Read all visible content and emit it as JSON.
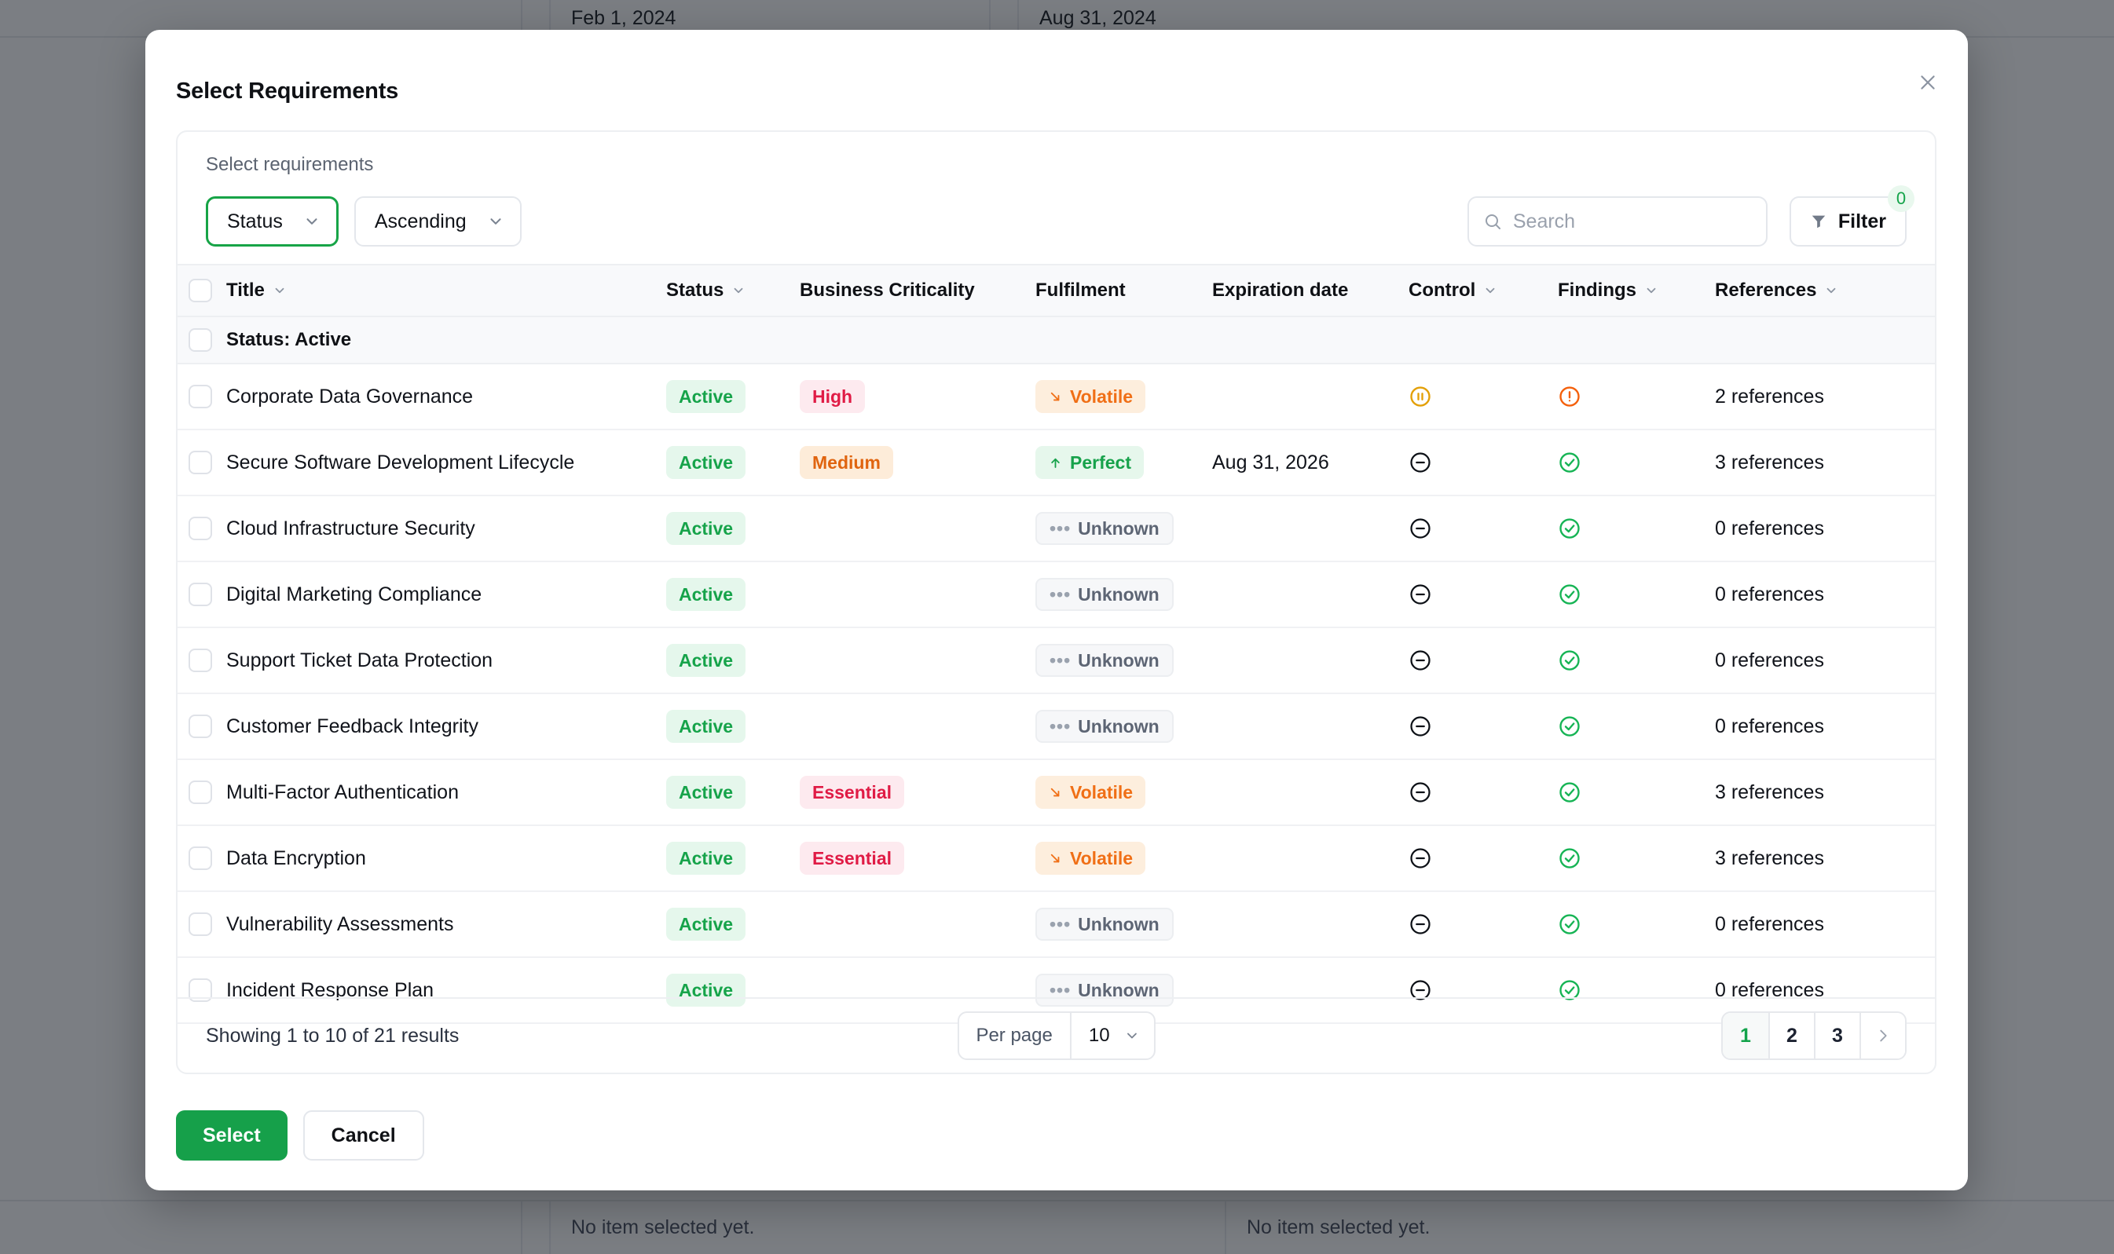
{
  "background": {
    "top_cells": [
      "Feb 1, 2024",
      "Aug 31, 2024"
    ],
    "bottom_cells": [
      "No item selected yet.",
      "No item selected yet."
    ]
  },
  "modal": {
    "title": "Select Requirements",
    "close_icon": "close-icon",
    "subtitle": "Select requirements",
    "toolbar": {
      "sort_field": "Status",
      "sort_direction": "Ascending",
      "chevron_icon": "chevron-down-icon",
      "search_placeholder": "Search",
      "search_value": "",
      "search_icon": "search-icon",
      "filter_label": "Filter",
      "filter_icon": "funnel-icon",
      "filter_count": "0"
    },
    "table": {
      "columns": [
        {
          "label": "Title",
          "sortable": true
        },
        {
          "label": "Status",
          "sortable": true
        },
        {
          "label": "Business Criticality",
          "sortable": false
        },
        {
          "label": "Fulfilment",
          "sortable": false
        },
        {
          "label": "Expiration date",
          "sortable": false
        },
        {
          "label": "Control",
          "sortable": true
        },
        {
          "label": "Findings",
          "sortable": true
        },
        {
          "label": "References",
          "sortable": true
        }
      ],
      "group_label": "Status: Active",
      "rows": [
        {
          "title": "Corporate Data Governance",
          "status": "Active",
          "criticality": "High",
          "criticality_tone": "red",
          "fulfilment": "Volatile",
          "fulfilment_tone": "volatile",
          "expiration": "",
          "control_icon": "pause-circle-icon",
          "findings_icon": "alert-circle-icon",
          "references": "2 references"
        },
        {
          "title": "Secure Software Development Lifecycle",
          "status": "Active",
          "criticality": "Medium",
          "criticality_tone": "orange",
          "fulfilment": "Perfect",
          "fulfilment_tone": "perfect",
          "expiration": "Aug 31, 2026",
          "control_icon": "minus-circle-icon",
          "findings_icon": "check-circle-icon",
          "references": "3 references"
        },
        {
          "title": "Cloud Infrastructure Security",
          "status": "Active",
          "criticality": "",
          "criticality_tone": "",
          "fulfilment": "Unknown",
          "fulfilment_tone": "unknown",
          "expiration": "",
          "control_icon": "minus-circle-icon",
          "findings_icon": "check-circle-icon",
          "references": "0 references"
        },
        {
          "title": "Digital Marketing Compliance",
          "status": "Active",
          "criticality": "",
          "criticality_tone": "",
          "fulfilment": "Unknown",
          "fulfilment_tone": "unknown",
          "expiration": "",
          "control_icon": "minus-circle-icon",
          "findings_icon": "check-circle-icon",
          "references": "0 references"
        },
        {
          "title": "Support Ticket Data Protection",
          "status": "Active",
          "criticality": "",
          "criticality_tone": "",
          "fulfilment": "Unknown",
          "fulfilment_tone": "unknown",
          "expiration": "",
          "control_icon": "minus-circle-icon",
          "findings_icon": "check-circle-icon",
          "references": "0 references"
        },
        {
          "title": "Customer Feedback Integrity",
          "status": "Active",
          "criticality": "",
          "criticality_tone": "",
          "fulfilment": "Unknown",
          "fulfilment_tone": "unknown",
          "expiration": "",
          "control_icon": "minus-circle-icon",
          "findings_icon": "check-circle-icon",
          "references": "0 references"
        },
        {
          "title": "Multi-Factor Authentication",
          "status": "Active",
          "criticality": "Essential",
          "criticality_tone": "red",
          "fulfilment": "Volatile",
          "fulfilment_tone": "volatile",
          "expiration": "",
          "control_icon": "minus-circle-icon",
          "findings_icon": "check-circle-icon",
          "references": "3 references"
        },
        {
          "title": "Data Encryption",
          "status": "Active",
          "criticality": "Essential",
          "criticality_tone": "red",
          "fulfilment": "Volatile",
          "fulfilment_tone": "volatile",
          "expiration": "",
          "control_icon": "minus-circle-icon",
          "findings_icon": "check-circle-icon",
          "references": "3 references"
        },
        {
          "title": "Vulnerability Assessments",
          "status": "Active",
          "criticality": "",
          "criticality_tone": "",
          "fulfilment": "Unknown",
          "fulfilment_tone": "unknown",
          "expiration": "",
          "control_icon": "minus-circle-icon",
          "findings_icon": "check-circle-icon",
          "references": "0 references"
        },
        {
          "title": "Incident Response Plan",
          "status": "Active",
          "criticality": "",
          "criticality_tone": "",
          "fulfilment": "Unknown",
          "fulfilment_tone": "unknown",
          "expiration": "",
          "control_icon": "minus-circle-icon",
          "findings_icon": "check-circle-icon",
          "references": "0 references"
        }
      ]
    },
    "footer": {
      "showing": "Showing 1 to 10 of 21 results",
      "per_page_label": "Per page",
      "per_page_value": "10",
      "pages": [
        "1",
        "2",
        "3"
      ],
      "active_page": "1",
      "next_icon": "chevron-right-icon"
    },
    "actions": {
      "select_label": "Select",
      "cancel_label": "Cancel"
    }
  },
  "colors": {
    "brand_green": "#16a04a",
    "status_green": "#16a34a",
    "critical_red": "#e01b45",
    "medium_orange": "#e0640f",
    "volatile_orange": "#f06f16",
    "warning_amber": "#e3a008",
    "findings_alert": "#f4600c"
  }
}
